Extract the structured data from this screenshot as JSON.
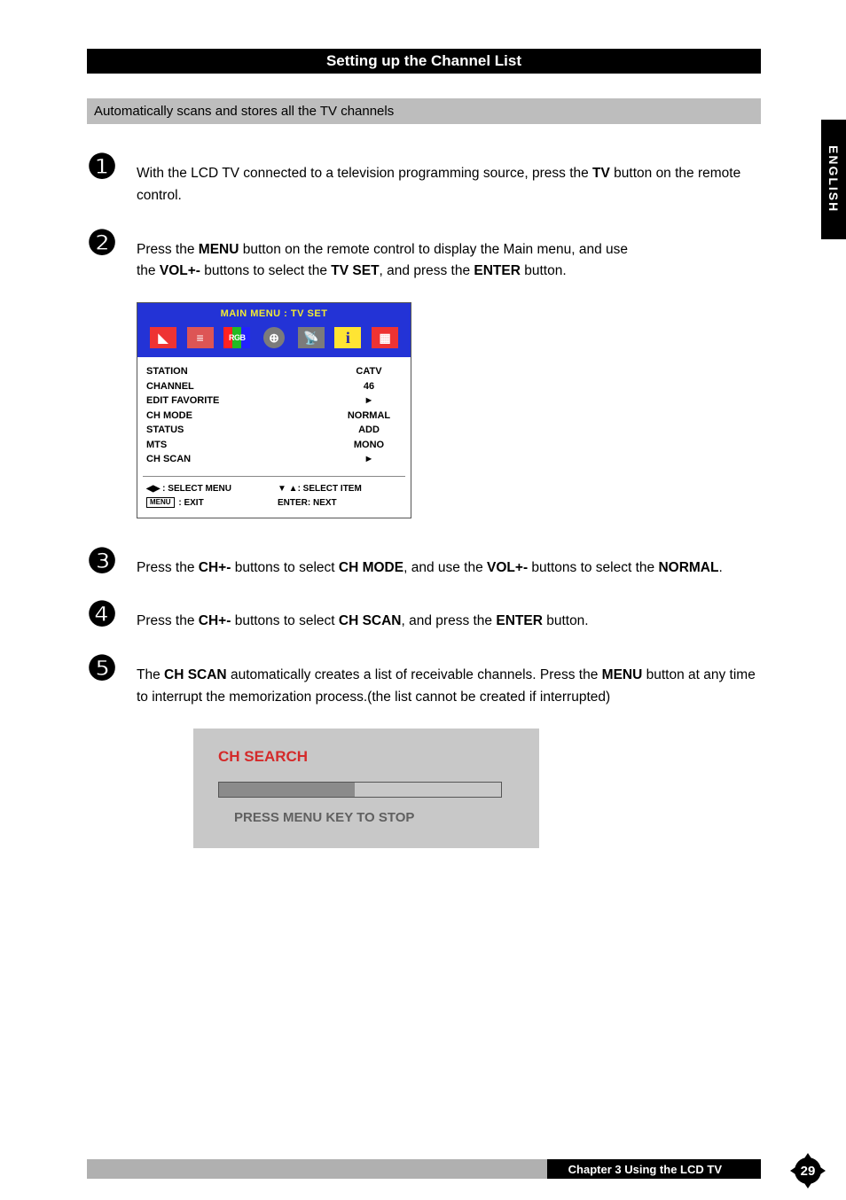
{
  "header": {
    "title": "Setting up the Channel List"
  },
  "subtitle": "Automatically scans and stores all the TV channels",
  "sideTab": "ENGLISH",
  "steps": {
    "s1": {
      "num": "❶",
      "pre": "With the LCD TV connected to a television programming source, press the ",
      "b1": "TV",
      "post": " button on the remote control."
    },
    "s2": {
      "num": "❷",
      "t1": "Press the ",
      "b1": "MENU",
      "t2": " button on the remote control to display the Main menu, and use",
      "t3": "the ",
      "b2": "VOL+-",
      "t4": " buttons to select the ",
      "b3": "TV SET",
      "t5": ", and press the ",
      "b4": "ENTER",
      "t6": " button."
    },
    "s3": {
      "num": "❸",
      "t1": "Press the ",
      "b1": "CH+-",
      "t2": " buttons to select ",
      "b2": "CH MODE",
      "t3": ", and use  the ",
      "b3": "VOL+-",
      "t4": " buttons to select the ",
      "b4": "NORMAL",
      "t5": "."
    },
    "s4": {
      "num": "❹",
      "t1": "Press the ",
      "b1": "CH+-",
      "t2": " buttons to select ",
      "b2": "CH SCAN",
      "t3": ", and press the ",
      "b3": "ENTER",
      "t4": " button."
    },
    "s5": {
      "num": "❺",
      "t1": "The ",
      "b1": "CH SCAN",
      "t2": " automatically creates a list of receivable channels. Press the ",
      "b2": "MENU",
      "t3": " button at any time to interrupt the memorization process.(the list cannot be created if interrupted)"
    }
  },
  "osd": {
    "title": "MAIN MENU : TV SET",
    "iconRgb": "RGB",
    "rows": [
      {
        "label": "STATION",
        "value": "CATV"
      },
      {
        "label": "CHANNEL",
        "value": "46"
      },
      {
        "label": "EDIT FAVORITE",
        "value": "►"
      },
      {
        "label": "CH MODE",
        "value": "NORMAL"
      },
      {
        "label": "STATUS",
        "value": "ADD"
      },
      {
        "label": "MTS",
        "value": "MONO"
      },
      {
        "label": "CH SCAN",
        "value": "►"
      }
    ],
    "footer": {
      "f1a": "◀▶",
      "f1b": " : SELECT MENU",
      "f2a": "▼ ▲",
      "f2b": ": SELECT ITEM",
      "f3a": "MENU",
      "f3b": " : EXIT",
      "f4": "ENTER: NEXT"
    }
  },
  "search": {
    "title": "CH SEARCH",
    "msg": "PRESS MENU KEY TO STOP"
  },
  "footer": {
    "chapter": "Chapter 3 Using the LCD TV",
    "page": "29"
  }
}
